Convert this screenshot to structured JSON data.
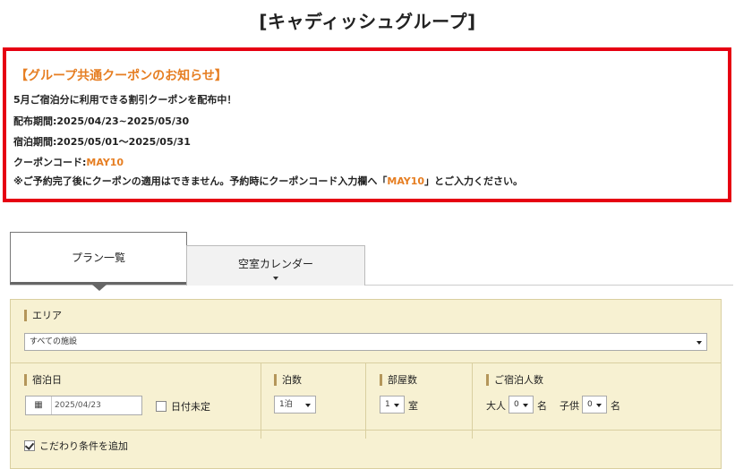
{
  "page": {
    "title": "[キャディッシュグループ]"
  },
  "notice": {
    "heading": "【グループ共通クーポンのお知らせ】",
    "line1": "5月ご宿泊分に利用できる割引クーポンを配布中！",
    "line2": "配布期間:2025/04/23~2025/05/30",
    "line3": "宿泊期間:2025/05/01～2025/05/31",
    "coupon_label": "クーポンコード:",
    "coupon_code": "MAY10",
    "note_before": "※ご予約完了後にクーポンの適用はできません。予約時にクーポンコード入力欄へ「",
    "note_code": "MAY10",
    "note_after": "」とご入力ください。"
  },
  "tabs": [
    {
      "label": "プラン一覧",
      "active": true
    },
    {
      "label": "空室カレンダー",
      "active": false
    }
  ],
  "search": {
    "area_label": "エリア",
    "area_value": "すべての施設",
    "date_label": "宿泊日",
    "date_value": "2025/04/23",
    "date_undecided_label": "日付未定",
    "date_undecided_checked": false,
    "nights_label": "泊数",
    "nights_value": "1泊",
    "rooms_label": "部屋数",
    "rooms_value": "1",
    "rooms_unit": "室",
    "guests_label": "ご宿泊人数",
    "adult_label": "大人",
    "adult_value": "0",
    "adult_unit": "名",
    "child_label": "子供",
    "child_value": "0",
    "child_unit": "名",
    "extra_conditions_label": "こだわり条件を追加",
    "extra_conditions_checked": true
  },
  "colors": {
    "notice_border": "#e60012",
    "accent": "#e67e22",
    "panel_bg": "#f7f1d2"
  }
}
